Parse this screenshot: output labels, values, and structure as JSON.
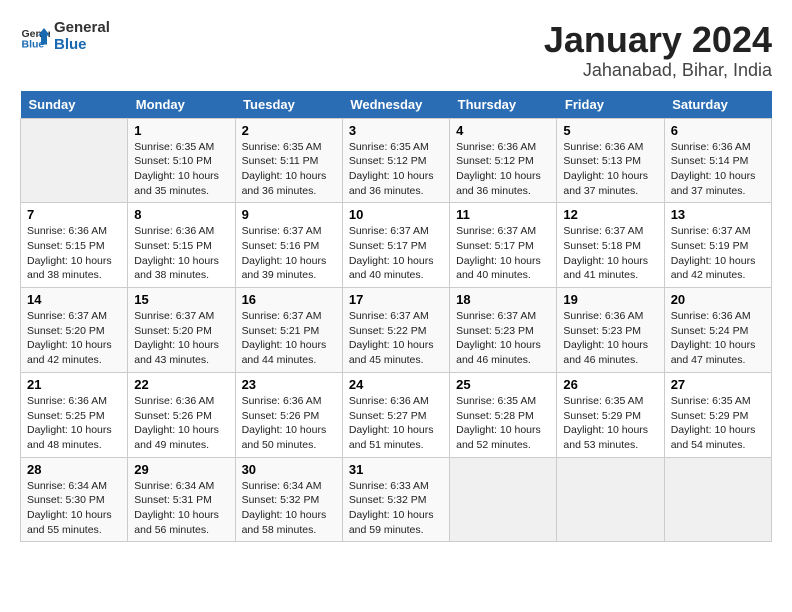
{
  "logo": {
    "text_general": "General",
    "text_blue": "Blue"
  },
  "title": "January 2024",
  "subtitle": "Jahanabad, Bihar, India",
  "days_of_week": [
    "Sunday",
    "Monday",
    "Tuesday",
    "Wednesday",
    "Thursday",
    "Friday",
    "Saturday"
  ],
  "weeks": [
    [
      {
        "day": "",
        "info": ""
      },
      {
        "day": "1",
        "info": "Sunrise: 6:35 AM\nSunset: 5:10 PM\nDaylight: 10 hours\nand 35 minutes."
      },
      {
        "day": "2",
        "info": "Sunrise: 6:35 AM\nSunset: 5:11 PM\nDaylight: 10 hours\nand 36 minutes."
      },
      {
        "day": "3",
        "info": "Sunrise: 6:35 AM\nSunset: 5:12 PM\nDaylight: 10 hours\nand 36 minutes."
      },
      {
        "day": "4",
        "info": "Sunrise: 6:36 AM\nSunset: 5:12 PM\nDaylight: 10 hours\nand 36 minutes."
      },
      {
        "day": "5",
        "info": "Sunrise: 6:36 AM\nSunset: 5:13 PM\nDaylight: 10 hours\nand 37 minutes."
      },
      {
        "day": "6",
        "info": "Sunrise: 6:36 AM\nSunset: 5:14 PM\nDaylight: 10 hours\nand 37 minutes."
      }
    ],
    [
      {
        "day": "7",
        "info": "Sunrise: 6:36 AM\nSunset: 5:15 PM\nDaylight: 10 hours\nand 38 minutes."
      },
      {
        "day": "8",
        "info": "Sunrise: 6:36 AM\nSunset: 5:15 PM\nDaylight: 10 hours\nand 38 minutes."
      },
      {
        "day": "9",
        "info": "Sunrise: 6:37 AM\nSunset: 5:16 PM\nDaylight: 10 hours\nand 39 minutes."
      },
      {
        "day": "10",
        "info": "Sunrise: 6:37 AM\nSunset: 5:17 PM\nDaylight: 10 hours\nand 40 minutes."
      },
      {
        "day": "11",
        "info": "Sunrise: 6:37 AM\nSunset: 5:17 PM\nDaylight: 10 hours\nand 40 minutes."
      },
      {
        "day": "12",
        "info": "Sunrise: 6:37 AM\nSunset: 5:18 PM\nDaylight: 10 hours\nand 41 minutes."
      },
      {
        "day": "13",
        "info": "Sunrise: 6:37 AM\nSunset: 5:19 PM\nDaylight: 10 hours\nand 42 minutes."
      }
    ],
    [
      {
        "day": "14",
        "info": "Sunrise: 6:37 AM\nSunset: 5:20 PM\nDaylight: 10 hours\nand 42 minutes."
      },
      {
        "day": "15",
        "info": "Sunrise: 6:37 AM\nSunset: 5:20 PM\nDaylight: 10 hours\nand 43 minutes."
      },
      {
        "day": "16",
        "info": "Sunrise: 6:37 AM\nSunset: 5:21 PM\nDaylight: 10 hours\nand 44 minutes."
      },
      {
        "day": "17",
        "info": "Sunrise: 6:37 AM\nSunset: 5:22 PM\nDaylight: 10 hours\nand 45 minutes."
      },
      {
        "day": "18",
        "info": "Sunrise: 6:37 AM\nSunset: 5:23 PM\nDaylight: 10 hours\nand 46 minutes."
      },
      {
        "day": "19",
        "info": "Sunrise: 6:36 AM\nSunset: 5:23 PM\nDaylight: 10 hours\nand 46 minutes."
      },
      {
        "day": "20",
        "info": "Sunrise: 6:36 AM\nSunset: 5:24 PM\nDaylight: 10 hours\nand 47 minutes."
      }
    ],
    [
      {
        "day": "21",
        "info": "Sunrise: 6:36 AM\nSunset: 5:25 PM\nDaylight: 10 hours\nand 48 minutes."
      },
      {
        "day": "22",
        "info": "Sunrise: 6:36 AM\nSunset: 5:26 PM\nDaylight: 10 hours\nand 49 minutes."
      },
      {
        "day": "23",
        "info": "Sunrise: 6:36 AM\nSunset: 5:26 PM\nDaylight: 10 hours\nand 50 minutes."
      },
      {
        "day": "24",
        "info": "Sunrise: 6:36 AM\nSunset: 5:27 PM\nDaylight: 10 hours\nand 51 minutes."
      },
      {
        "day": "25",
        "info": "Sunrise: 6:35 AM\nSunset: 5:28 PM\nDaylight: 10 hours\nand 52 minutes."
      },
      {
        "day": "26",
        "info": "Sunrise: 6:35 AM\nSunset: 5:29 PM\nDaylight: 10 hours\nand 53 minutes."
      },
      {
        "day": "27",
        "info": "Sunrise: 6:35 AM\nSunset: 5:29 PM\nDaylight: 10 hours\nand 54 minutes."
      }
    ],
    [
      {
        "day": "28",
        "info": "Sunrise: 6:34 AM\nSunset: 5:30 PM\nDaylight: 10 hours\nand 55 minutes."
      },
      {
        "day": "29",
        "info": "Sunrise: 6:34 AM\nSunset: 5:31 PM\nDaylight: 10 hours\nand 56 minutes."
      },
      {
        "day": "30",
        "info": "Sunrise: 6:34 AM\nSunset: 5:32 PM\nDaylight: 10 hours\nand 58 minutes."
      },
      {
        "day": "31",
        "info": "Sunrise: 6:33 AM\nSunset: 5:32 PM\nDaylight: 10 hours\nand 59 minutes."
      },
      {
        "day": "",
        "info": ""
      },
      {
        "day": "",
        "info": ""
      },
      {
        "day": "",
        "info": ""
      }
    ]
  ]
}
